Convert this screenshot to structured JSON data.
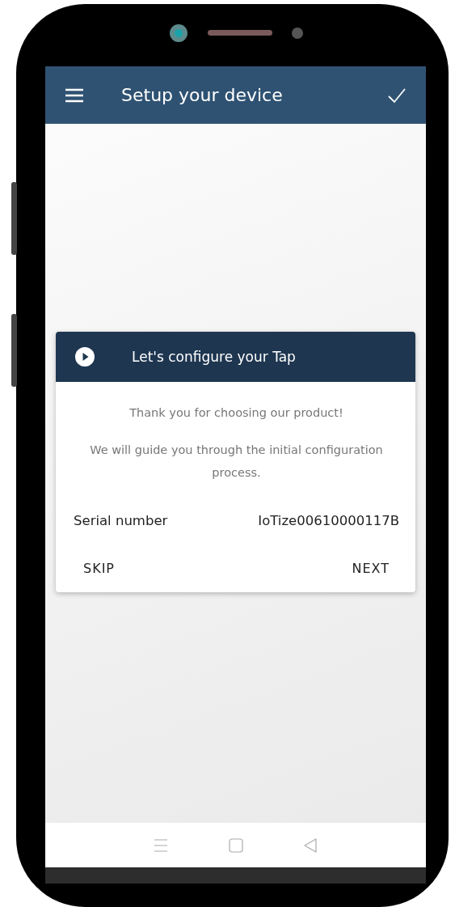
{
  "app_bar": {
    "title": "Setup your device"
  },
  "card": {
    "title": "Let's configure your Tap",
    "message": "Thank you for choosing our product!",
    "description": "We will guide you through the initial configuration process.",
    "fields": [
      {
        "label": "Serial number",
        "value": "IoTize00610000117B"
      }
    ],
    "actions": [
      "SKIP",
      "NEXT"
    ]
  }
}
